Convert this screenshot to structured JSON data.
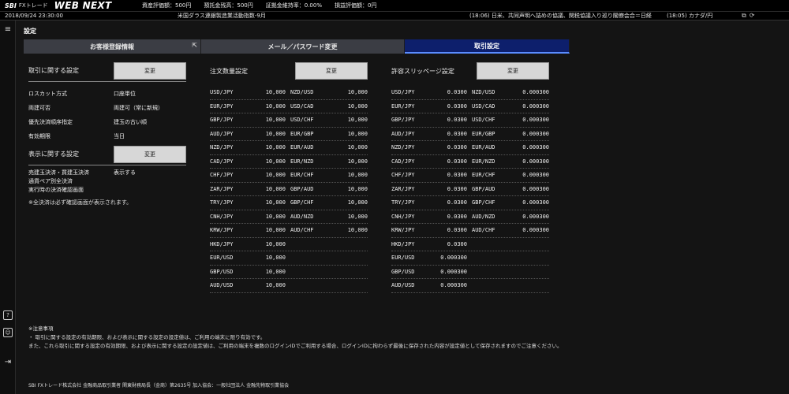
{
  "brand": {
    "sbi": "SBI",
    "fxtrade": "FXトレード",
    "webnext": "WEB NEXT"
  },
  "top_stats": [
    "資産評価額：500円",
    "預託金残高：500円",
    "証拠金維持率：0.00%",
    "損益評価額：0円"
  ],
  "ticker": {
    "date": "2018/09/24 23:30:00",
    "econ": "米国ダラス連銀製造業活動指数-9月",
    "news1": "(18:06) 日米、共同声明へ詰めの協議、関税協議入り巡り閣僚会合＝日経",
    "news2": "(18:05) カナダ/円"
  },
  "page": {
    "title": "設定"
  },
  "tabs": [
    {
      "label": "お客様登録情報"
    },
    {
      "label": "メール／パスワード変更"
    },
    {
      "label": "取引設定"
    }
  ],
  "trade_settings": {
    "section_label": "取引に関する設定",
    "change_label": "変更",
    "items": [
      {
        "k": "ロスカット方式",
        "v": "口座単位"
      },
      {
        "k": "両建可否",
        "v": "両建可（常に新規）"
      },
      {
        "k": "優先決済順序指定",
        "v": "建玉の古い順"
      },
      {
        "k": "有効期限",
        "v": "当日"
      }
    ]
  },
  "display_settings": {
    "section_label": "表示に関する設定",
    "change_label": "変更",
    "item_k1": "売建玉決済・買建玉決済",
    "item_k2": "通貨ペア別全決済",
    "item_k3": "実行時の決済確認画面",
    "item_v": "表示する",
    "note": "※全決済は必ず確認画面が表示されます。"
  },
  "order_qty": {
    "label": "注文数量設定",
    "change_label": "変更",
    "rows": [
      [
        "USD/JPY",
        "10,000",
        "NZD/USD",
        "10,000"
      ],
      [
        "EUR/JPY",
        "10,000",
        "USD/CAD",
        "10,000"
      ],
      [
        "GBP/JPY",
        "10,000",
        "USD/CHF",
        "10,000"
      ],
      [
        "AUD/JPY",
        "10,000",
        "EUR/GBP",
        "10,000"
      ],
      [
        "NZD/JPY",
        "10,000",
        "EUR/AUD",
        "10,000"
      ],
      [
        "CAD/JPY",
        "10,000",
        "EUR/NZD",
        "10,000"
      ],
      [
        "CHF/JPY",
        "10,000",
        "EUR/CHF",
        "10,000"
      ],
      [
        "ZAR/JPY",
        "10,000",
        "GBP/AUD",
        "10,000"
      ],
      [
        "TRY/JPY",
        "10,000",
        "GBP/CHF",
        "10,000"
      ],
      [
        "CNH/JPY",
        "10,000",
        "AUD/NZD",
        "10,000"
      ],
      [
        "KRW/JPY",
        "10,000",
        "AUD/CHF",
        "10,000"
      ],
      [
        "HKD/JPY",
        "10,000",
        "",
        ""
      ],
      [
        "EUR/USD",
        "10,000",
        "",
        ""
      ],
      [
        "GBP/USD",
        "10,000",
        "",
        ""
      ],
      [
        "AUD/USD",
        "10,000",
        "",
        ""
      ]
    ]
  },
  "slippage": {
    "label": "許容スリッページ設定",
    "change_label": "変更",
    "rows": [
      [
        "USD/JPY",
        "0.0300",
        "NZD/USD",
        "0.000300"
      ],
      [
        "EUR/JPY",
        "0.0300",
        "USD/CAD",
        "0.000300"
      ],
      [
        "GBP/JPY",
        "0.0300",
        "USD/CHF",
        "0.000300"
      ],
      [
        "AUD/JPY",
        "0.0300",
        "EUR/GBP",
        "0.000300"
      ],
      [
        "NZD/JPY",
        "0.0300",
        "EUR/AUD",
        "0.000300"
      ],
      [
        "CAD/JPY",
        "0.0300",
        "EUR/NZD",
        "0.000300"
      ],
      [
        "CHF/JPY",
        "0.0300",
        "EUR/CHF",
        "0.000300"
      ],
      [
        "ZAR/JPY",
        "0.0300",
        "GBP/AUD",
        "0.000300"
      ],
      [
        "TRY/JPY",
        "0.0300",
        "GBP/CHF",
        "0.000300"
      ],
      [
        "CNH/JPY",
        "0.0300",
        "AUD/NZD",
        "0.000300"
      ],
      [
        "KRW/JPY",
        "0.0300",
        "AUD/CHF",
        "0.000300"
      ],
      [
        "HKD/JPY",
        "0.0300",
        "",
        ""
      ],
      [
        "EUR/USD",
        "0.000300",
        "",
        ""
      ],
      [
        "GBP/USD",
        "0.000300",
        "",
        ""
      ],
      [
        "AUD/USD",
        "0.000300",
        "",
        ""
      ]
    ]
  },
  "notes": {
    "title": "※注意事項",
    "line1": "・ 取引に関する設定の有効期限、および表示に関する設定の設定値は、ご利用の端末に限り有効です。",
    "line2": "また、これら取引に関する設定の有効期限、および表示に関する設定の設定値は、ご利用の端末を複数のログインIDでご利用する場合、ログインIDに拘わらず最後に保存された内容が設定値として保存されますのでご注意ください。"
  },
  "legal": "SBI FXトレード株式会社 金融商品取引業者 関東財務局長（金商）第2635号 加入協会：一般社団法人 金融先物取引業協会"
}
